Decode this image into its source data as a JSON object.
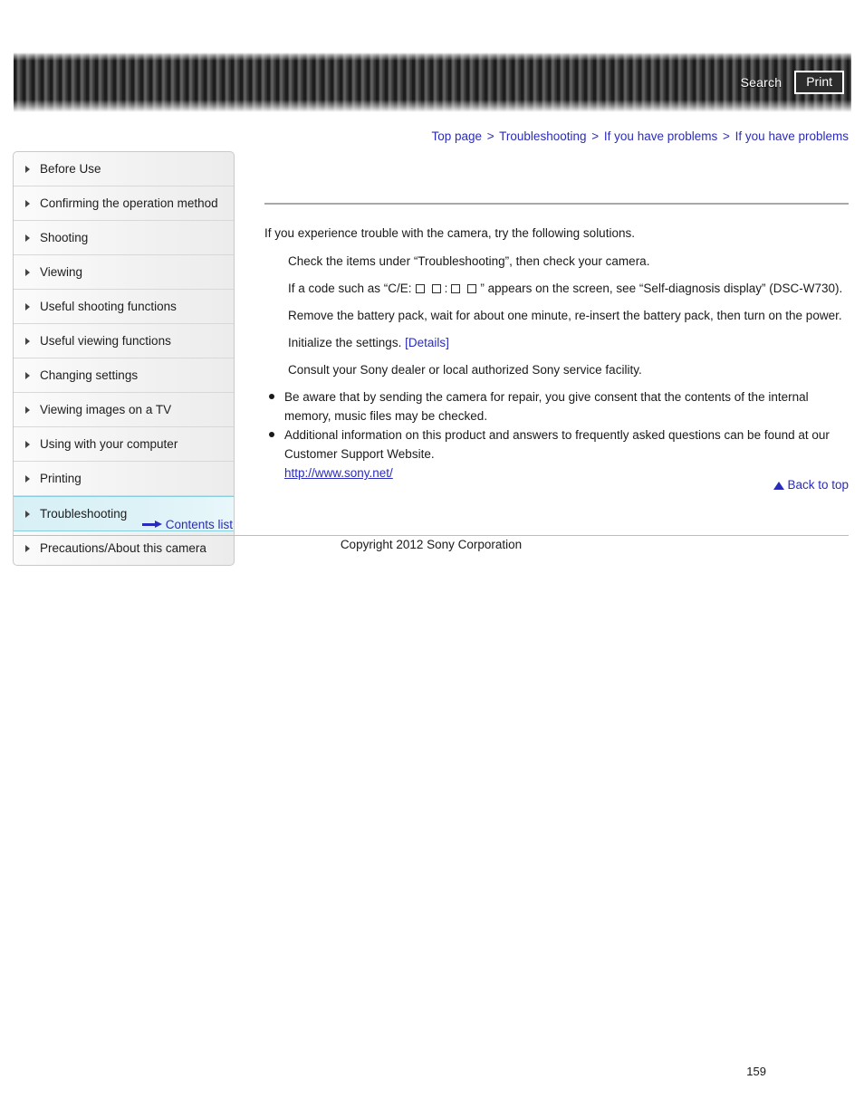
{
  "header": {
    "search_label": "Search",
    "print_label": "Print"
  },
  "breadcrumb": {
    "separator": ">",
    "items": [
      {
        "label": "Top page"
      },
      {
        "label": "Troubleshooting"
      },
      {
        "label": "If you have problems"
      },
      {
        "label": "If you have problems"
      }
    ]
  },
  "sidebar": {
    "items": [
      {
        "label": "Before Use",
        "active": false
      },
      {
        "label": "Confirming the operation method",
        "active": false
      },
      {
        "label": "Shooting",
        "active": false
      },
      {
        "label": "Viewing",
        "active": false
      },
      {
        "label": "Useful shooting functions",
        "active": false
      },
      {
        "label": "Useful viewing functions",
        "active": false
      },
      {
        "label": "Changing settings",
        "active": false
      },
      {
        "label": "Viewing images on a TV",
        "active": false
      },
      {
        "label": "Using with your computer",
        "active": false
      },
      {
        "label": "Printing",
        "active": false
      },
      {
        "label": "Troubleshooting",
        "active": true
      },
      {
        "label": "Precautions/About this camera",
        "active": false
      }
    ],
    "contents_list_label": "Contents list"
  },
  "content": {
    "intro": "If you experience trouble with the camera, try the following solutions.",
    "step1": "Check the items under “Troubleshooting”, then check your camera.",
    "step2_part1": "If a code such as “C/E:",
    "step2_colon": ":",
    "step2_part2": "” appears on the screen, see “Self-diagnosis display” (DSC-W730).",
    "step3": "Remove the battery pack, wait for about one minute, re-insert the battery pack, then turn on the power.",
    "step4_text": "Initialize the settings.",
    "step4_link": "[Details]",
    "step5": "Consult your Sony dealer or local authorized Sony service facility.",
    "bullet1": "Be aware that by sending the camera for repair, you give consent that the contents of the internal memory, music files may be checked.",
    "bullet2": "Additional information on this product and answers to frequently asked questions can be found at our Customer Support Website.",
    "support_url": "http://www.sony.net/"
  },
  "footer": {
    "back_to_top_label": "Back to top",
    "copyright": "Copyright 2012 Sony Corporation",
    "page_number": "159"
  },
  "colors": {
    "link": "#2b2bbb",
    "active_item_bg": "#ddf2f7",
    "active_item_border": "#86cfe0",
    "header_bg": "#3a3a3a"
  }
}
